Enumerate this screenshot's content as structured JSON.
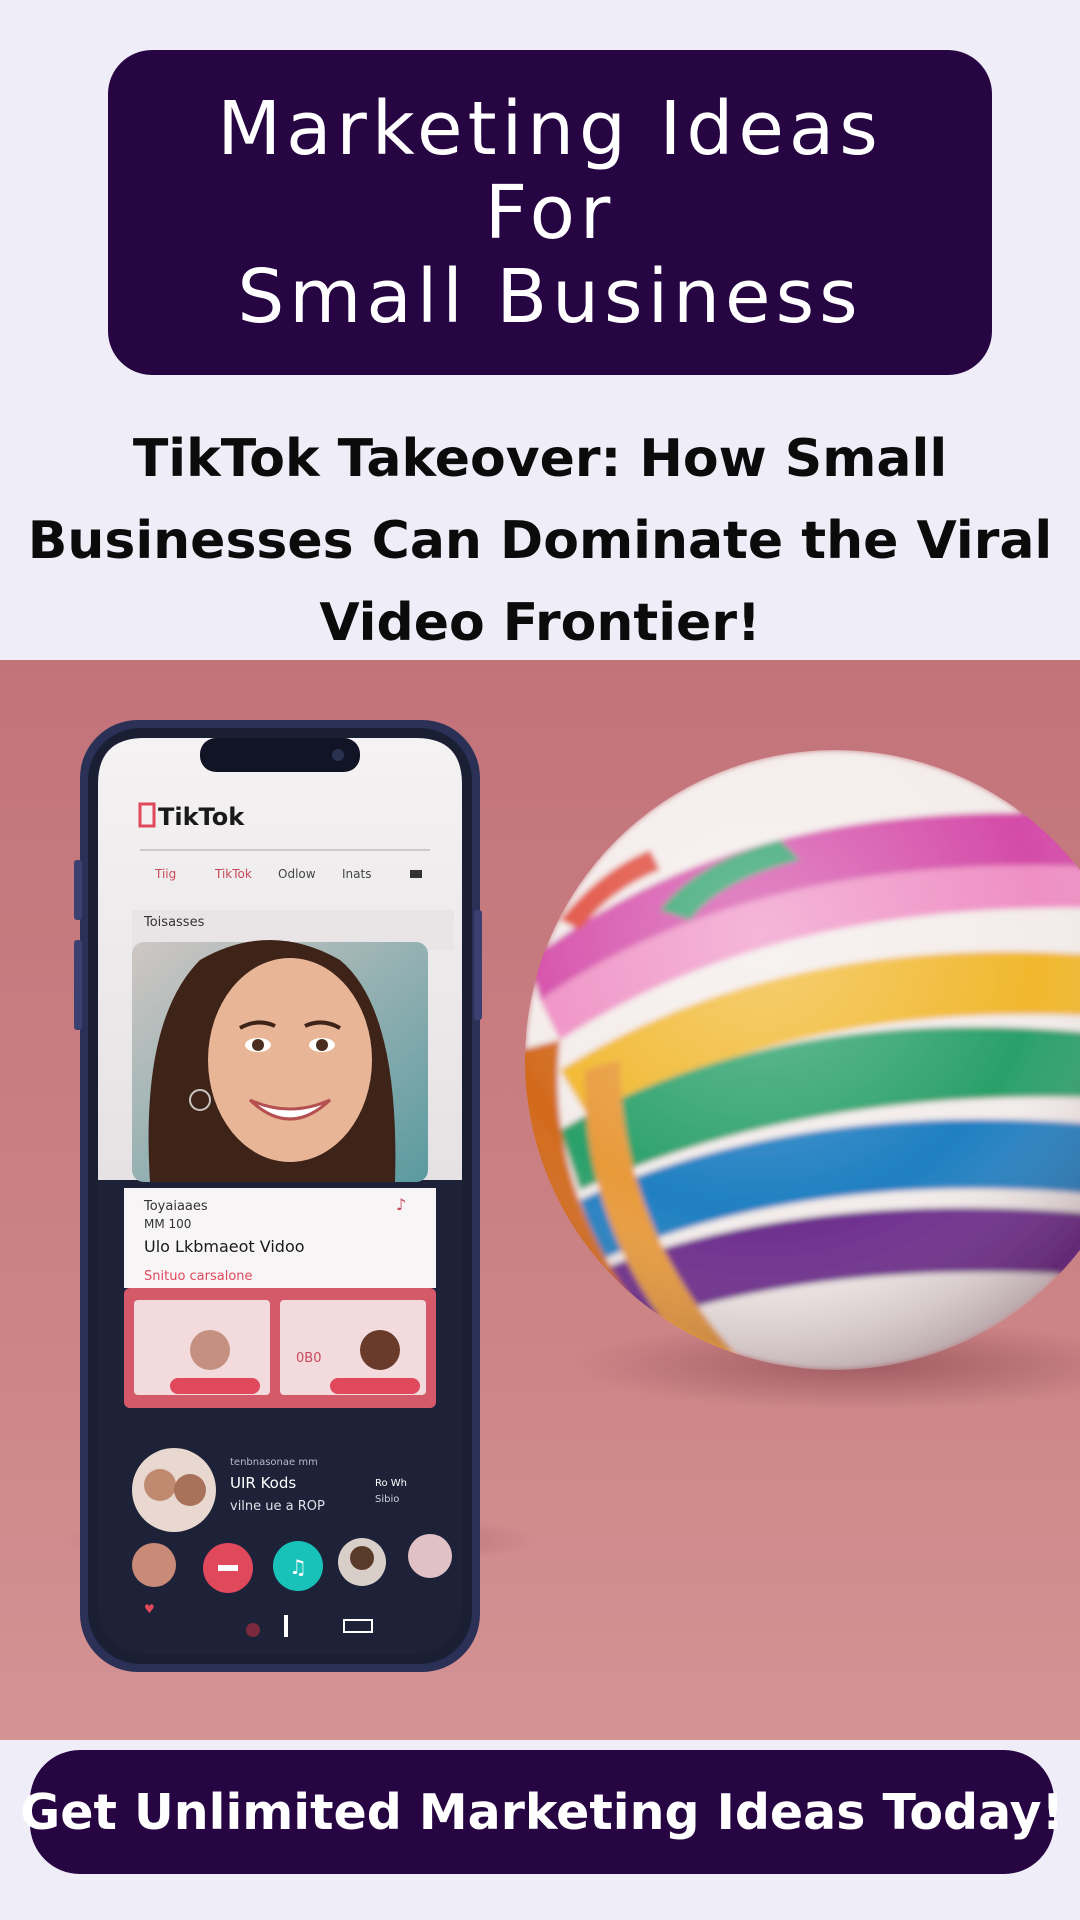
{
  "header": {
    "title_lines": [
      "Marketing Ideas",
      "For",
      "Small Business"
    ]
  },
  "subtitle": {
    "lines": [
      "TikTok Takeover: How Small",
      "Businesses Can Dominate the Viral",
      "Video Frontier!"
    ]
  },
  "phone_screen": {
    "app_name": "TikTok",
    "nav_items": [
      "Tiig",
      "TikTok",
      "Odlow",
      "Inats"
    ],
    "section_label": "Toisasses",
    "card_heading": "Toyaiaaes",
    "card_small": "MM 100",
    "card_title": "Ulo Lkbmaeot Vidoo",
    "card_link": "Snituo carsalone",
    "card_price": "0B0",
    "profile_top": "tenbnasonae mm",
    "profile_name": "UIR Kods",
    "profile_sub": "vilne ue a ROP",
    "profile_side_1": "Ro Wh",
    "profile_side_2": "Sibio"
  },
  "cta": {
    "label": "Get Unlimited Marketing Ideas Today!"
  },
  "colors": {
    "page_bg": "#efedf7",
    "brand_purple": "#260542",
    "hero_pink": "#c77c80",
    "tiktok_red": "#e0485c"
  }
}
